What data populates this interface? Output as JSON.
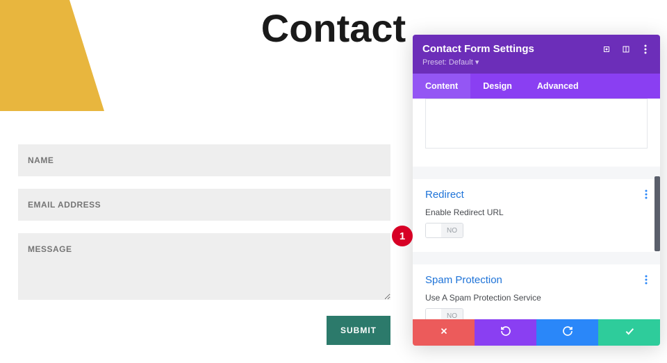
{
  "page": {
    "title": "Contact"
  },
  "form": {
    "name_placeholder": "NAME",
    "email_placeholder": "EMAIL ADDRESS",
    "message_placeholder": "MESSAGE",
    "submit_label": "SUBMIT"
  },
  "annotation": {
    "label": "1"
  },
  "panel": {
    "title": "Contact Form Settings",
    "preset_label": "Preset: Default",
    "tabs": [
      {
        "label": "Content",
        "active": true
      },
      {
        "label": "Design",
        "active": false
      },
      {
        "label": "Advanced",
        "active": false
      }
    ],
    "sections": {
      "redirect": {
        "title": "Redirect",
        "option_label": "Enable Redirect URL",
        "toggle_value": "NO"
      },
      "spam": {
        "title": "Spam Protection",
        "option_label": "Use A Spam Protection Service",
        "toggle_value": "NO"
      }
    }
  }
}
